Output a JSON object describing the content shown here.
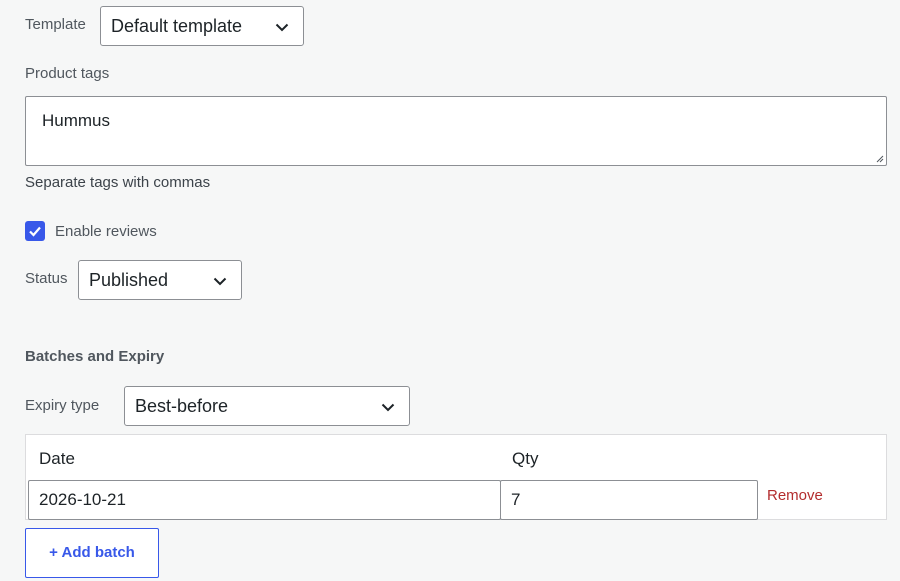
{
  "template": {
    "label": "Template",
    "selected": "Default template"
  },
  "tags": {
    "label": "Product tags",
    "value": "Hummus",
    "help": "Separate tags with commas"
  },
  "reviews": {
    "label": "Enable reviews",
    "checked": true
  },
  "status": {
    "label": "Status",
    "selected": "Published"
  },
  "batches": {
    "title": "Batches and Expiry",
    "expiry_label": "Expiry type",
    "expiry_selected": "Best-before",
    "columns": [
      "Date",
      "Qty"
    ],
    "rows": [
      {
        "date": "2026-10-21",
        "qty": "7",
        "remove_label": "Remove"
      }
    ],
    "add_label": "+ Add batch"
  },
  "colors": {
    "accent": "#3858e9",
    "danger": "#b32d2e"
  },
  "icons": {
    "select": "chevron-down-icon",
    "checkbox": "check-icon",
    "textarea": "resize-grip-icon"
  }
}
